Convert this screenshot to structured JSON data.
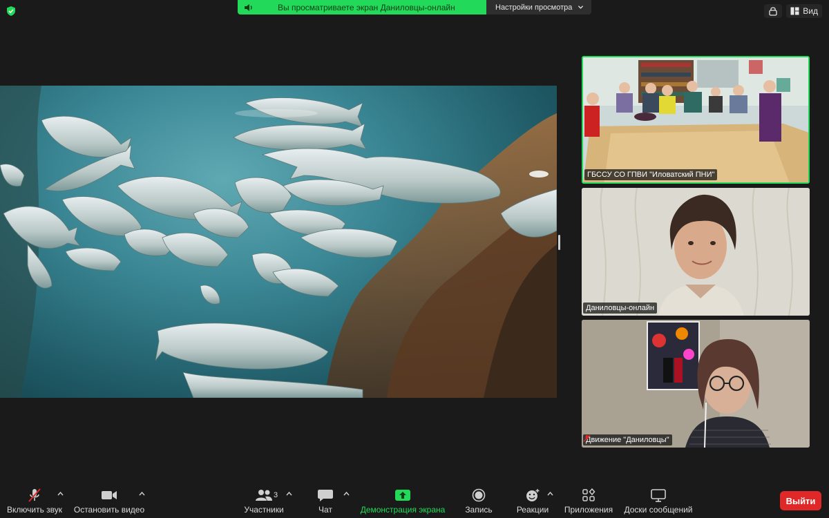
{
  "top_bar": {
    "share_banner_text": "Вы просматриваете экран Даниловцы-онлайн",
    "view_settings_label": "Настройки просмотра",
    "view_label": "Вид",
    "colors": {
      "banner": "#23d959",
      "active_speaker_border": "#23d959"
    }
  },
  "participants": [
    {
      "name": "ГБССУ СО ГПВИ \"Иловатский ПНИ\"",
      "muted": false,
      "active_speaker": true
    },
    {
      "name": "Даниловцы-онлайн",
      "muted": false,
      "active_speaker": false
    },
    {
      "name": "Движение \"Даниловцы\"",
      "muted": true,
      "active_speaker": false
    }
  ],
  "toolbar": {
    "unmute_label": "Включить звук",
    "stop_video_label": "Остановить видео",
    "participants_label": "Участники",
    "participants_count": "3",
    "chat_label": "Чат",
    "share_screen_label": "Демонстрация экрана",
    "record_label": "Запись",
    "reactions_label": "Реакции",
    "apps_label": "Приложения",
    "whiteboards_label": "Доски сообщений",
    "leave_label": "Выйти",
    "colors": {
      "share": "#23d959",
      "leave": "#e02828"
    }
  },
  "icons": [
    "shield-check-icon",
    "speaker-icon",
    "chevron-down-icon",
    "meeting-info-icon",
    "gallery-view-icon",
    "mic-muted-icon",
    "video-camera-icon",
    "participants-icon",
    "chat-icon",
    "share-screen-icon",
    "record-icon",
    "reactions-icon",
    "apps-icon",
    "whiteboard-icon"
  ]
}
